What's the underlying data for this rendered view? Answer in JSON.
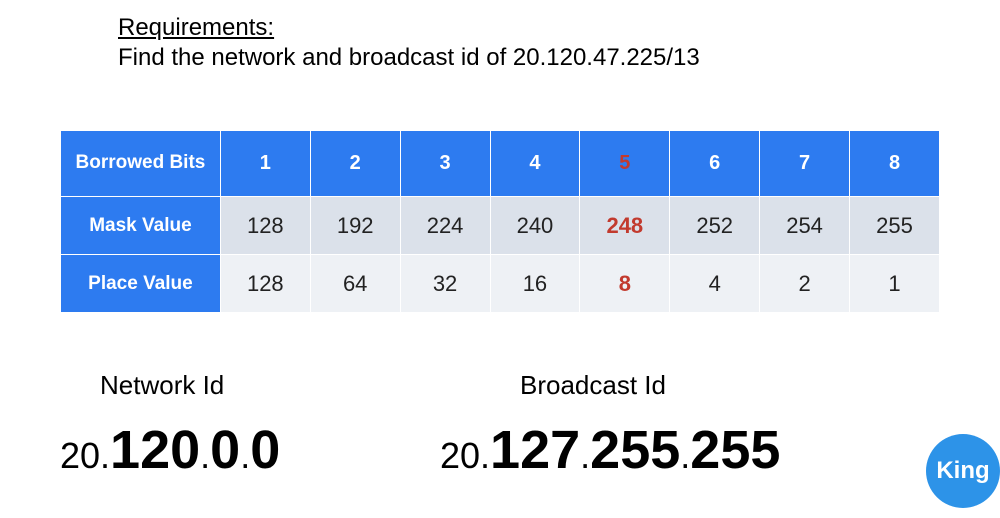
{
  "requirements": {
    "title": "Requirements:",
    "body": "Find the network and broadcast id of 20.120.47.225/13"
  },
  "table": {
    "row_labels": {
      "borrowed": "Borrowed Bits",
      "mask": "Mask Value",
      "place": "Place Value"
    },
    "borrowed_bits": [
      "1",
      "2",
      "3",
      "4",
      "5",
      "6",
      "7",
      "8"
    ],
    "mask_values": [
      "128",
      "192",
      "224",
      "240",
      "248",
      "252",
      "254",
      "255"
    ],
    "place_values": [
      "128",
      "64",
      "32",
      "16",
      "8",
      "4",
      "2",
      "1"
    ],
    "highlight_index": 4
  },
  "results": {
    "network": {
      "label": "Network Id",
      "prefix": "20.",
      "octets": [
        "120",
        "0",
        "0"
      ]
    },
    "broadcast": {
      "label": "Broadcast Id",
      "prefix": "20.",
      "octets": [
        "127",
        "255",
        "255"
      ]
    }
  },
  "logo": {
    "text": "King"
  },
  "chart_data": {
    "type": "table",
    "title": "Subnet bit table",
    "columns": [
      "Borrowed Bits",
      "1",
      "2",
      "3",
      "4",
      "5",
      "6",
      "7",
      "8"
    ],
    "rows": [
      [
        "Mask Value",
        128,
        192,
        224,
        240,
        248,
        252,
        254,
        255
      ],
      [
        "Place Value",
        128,
        64,
        32,
        16,
        8,
        4,
        2,
        1
      ]
    ],
    "highlight_column": 5
  }
}
